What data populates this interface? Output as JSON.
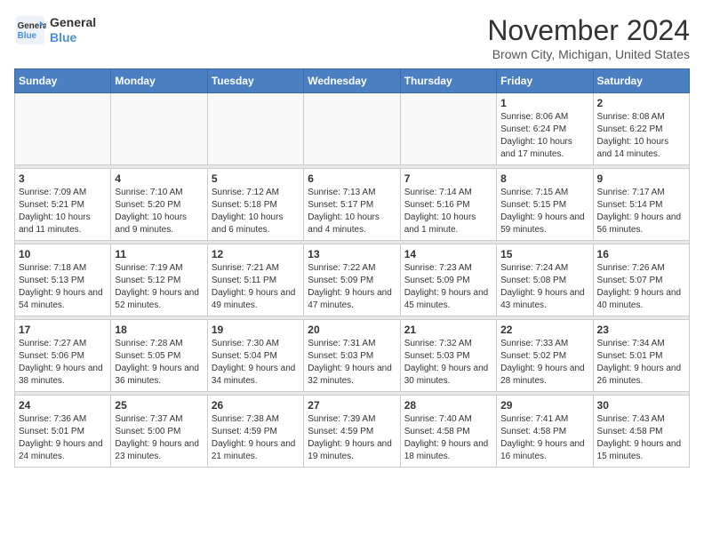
{
  "header": {
    "logo_line1": "General",
    "logo_line2": "Blue",
    "month_title": "November 2024",
    "location": "Brown City, Michigan, United States"
  },
  "weekdays": [
    "Sunday",
    "Monday",
    "Tuesday",
    "Wednesday",
    "Thursday",
    "Friday",
    "Saturday"
  ],
  "weeks": [
    [
      {
        "day": "",
        "info": ""
      },
      {
        "day": "",
        "info": ""
      },
      {
        "day": "",
        "info": ""
      },
      {
        "day": "",
        "info": ""
      },
      {
        "day": "",
        "info": ""
      },
      {
        "day": "1",
        "info": "Sunrise: 8:06 AM\nSunset: 6:24 PM\nDaylight: 10 hours and 17 minutes."
      },
      {
        "day": "2",
        "info": "Sunrise: 8:08 AM\nSunset: 6:22 PM\nDaylight: 10 hours and 14 minutes."
      }
    ],
    [
      {
        "day": "3",
        "info": "Sunrise: 7:09 AM\nSunset: 5:21 PM\nDaylight: 10 hours and 11 minutes."
      },
      {
        "day": "4",
        "info": "Sunrise: 7:10 AM\nSunset: 5:20 PM\nDaylight: 10 hours and 9 minutes."
      },
      {
        "day": "5",
        "info": "Sunrise: 7:12 AM\nSunset: 5:18 PM\nDaylight: 10 hours and 6 minutes."
      },
      {
        "day": "6",
        "info": "Sunrise: 7:13 AM\nSunset: 5:17 PM\nDaylight: 10 hours and 4 minutes."
      },
      {
        "day": "7",
        "info": "Sunrise: 7:14 AM\nSunset: 5:16 PM\nDaylight: 10 hours and 1 minute."
      },
      {
        "day": "8",
        "info": "Sunrise: 7:15 AM\nSunset: 5:15 PM\nDaylight: 9 hours and 59 minutes."
      },
      {
        "day": "9",
        "info": "Sunrise: 7:17 AM\nSunset: 5:14 PM\nDaylight: 9 hours and 56 minutes."
      }
    ],
    [
      {
        "day": "10",
        "info": "Sunrise: 7:18 AM\nSunset: 5:13 PM\nDaylight: 9 hours and 54 minutes."
      },
      {
        "day": "11",
        "info": "Sunrise: 7:19 AM\nSunset: 5:12 PM\nDaylight: 9 hours and 52 minutes."
      },
      {
        "day": "12",
        "info": "Sunrise: 7:21 AM\nSunset: 5:11 PM\nDaylight: 9 hours and 49 minutes."
      },
      {
        "day": "13",
        "info": "Sunrise: 7:22 AM\nSunset: 5:09 PM\nDaylight: 9 hours and 47 minutes."
      },
      {
        "day": "14",
        "info": "Sunrise: 7:23 AM\nSunset: 5:09 PM\nDaylight: 9 hours and 45 minutes."
      },
      {
        "day": "15",
        "info": "Sunrise: 7:24 AM\nSunset: 5:08 PM\nDaylight: 9 hours and 43 minutes."
      },
      {
        "day": "16",
        "info": "Sunrise: 7:26 AM\nSunset: 5:07 PM\nDaylight: 9 hours and 40 minutes."
      }
    ],
    [
      {
        "day": "17",
        "info": "Sunrise: 7:27 AM\nSunset: 5:06 PM\nDaylight: 9 hours and 38 minutes."
      },
      {
        "day": "18",
        "info": "Sunrise: 7:28 AM\nSunset: 5:05 PM\nDaylight: 9 hours and 36 minutes."
      },
      {
        "day": "19",
        "info": "Sunrise: 7:30 AM\nSunset: 5:04 PM\nDaylight: 9 hours and 34 minutes."
      },
      {
        "day": "20",
        "info": "Sunrise: 7:31 AM\nSunset: 5:03 PM\nDaylight: 9 hours and 32 minutes."
      },
      {
        "day": "21",
        "info": "Sunrise: 7:32 AM\nSunset: 5:03 PM\nDaylight: 9 hours and 30 minutes."
      },
      {
        "day": "22",
        "info": "Sunrise: 7:33 AM\nSunset: 5:02 PM\nDaylight: 9 hours and 28 minutes."
      },
      {
        "day": "23",
        "info": "Sunrise: 7:34 AM\nSunset: 5:01 PM\nDaylight: 9 hours and 26 minutes."
      }
    ],
    [
      {
        "day": "24",
        "info": "Sunrise: 7:36 AM\nSunset: 5:01 PM\nDaylight: 9 hours and 24 minutes."
      },
      {
        "day": "25",
        "info": "Sunrise: 7:37 AM\nSunset: 5:00 PM\nDaylight: 9 hours and 23 minutes."
      },
      {
        "day": "26",
        "info": "Sunrise: 7:38 AM\nSunset: 4:59 PM\nDaylight: 9 hours and 21 minutes."
      },
      {
        "day": "27",
        "info": "Sunrise: 7:39 AM\nSunset: 4:59 PM\nDaylight: 9 hours and 19 minutes."
      },
      {
        "day": "28",
        "info": "Sunrise: 7:40 AM\nSunset: 4:58 PM\nDaylight: 9 hours and 18 minutes."
      },
      {
        "day": "29",
        "info": "Sunrise: 7:41 AM\nSunset: 4:58 PM\nDaylight: 9 hours and 16 minutes."
      },
      {
        "day": "30",
        "info": "Sunrise: 7:43 AM\nSunset: 4:58 PM\nDaylight: 9 hours and 15 minutes."
      }
    ]
  ]
}
